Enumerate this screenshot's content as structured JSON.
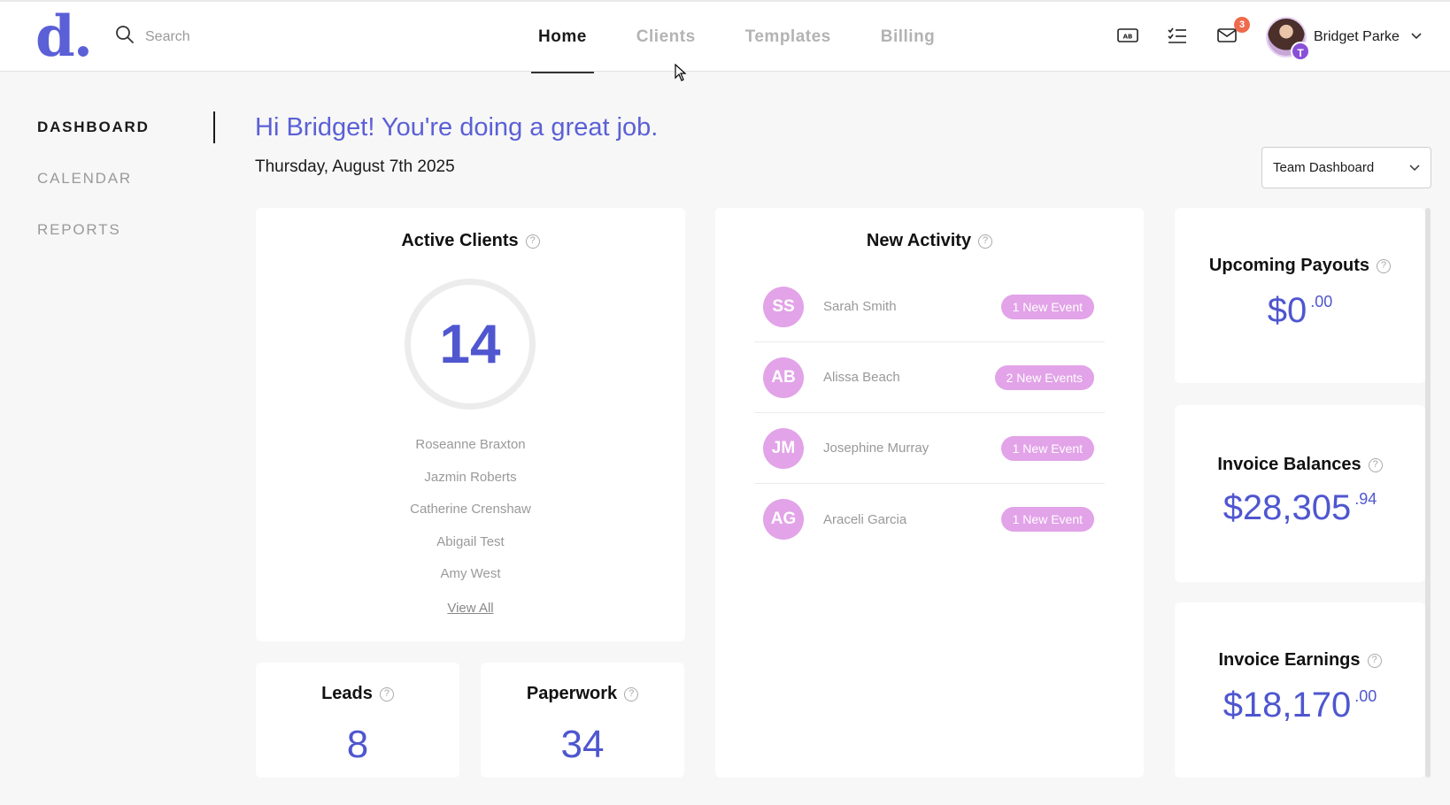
{
  "header": {
    "logo": "d.",
    "search_placeholder": "Search",
    "nav": [
      {
        "label": "Home",
        "active": true
      },
      {
        "label": "Clients",
        "active": false
      },
      {
        "label": "Templates",
        "active": false
      },
      {
        "label": "Billing",
        "active": false
      }
    ],
    "icons": [
      "ab-icon",
      "checklist-icon",
      "mail-icon"
    ],
    "mail_badge": "3",
    "user": {
      "name": "Bridget Parke",
      "avatar_badge": "T"
    }
  },
  "sidebar": {
    "items": [
      {
        "label": "DASHBOARD",
        "active": true
      },
      {
        "label": "CALENDAR",
        "active": false
      },
      {
        "label": "REPORTS",
        "active": false
      }
    ]
  },
  "main": {
    "greeting": "Hi Bridget! You're doing a great job.",
    "date": "Thursday, August 7th 2025",
    "dashboard_select": "Team Dashboard"
  },
  "active_clients": {
    "title": "Active Clients",
    "count": "14",
    "clients": [
      "Roseanne Braxton",
      "Jazmin Roberts",
      "Catherine Crenshaw",
      "Abigail Test",
      "Amy West"
    ],
    "view_all": "View All"
  },
  "leads": {
    "title": "Leads",
    "value": "8"
  },
  "paperwork": {
    "title": "Paperwork",
    "value": "34"
  },
  "activity": {
    "title": "New Activity",
    "items": [
      {
        "initials": "SS",
        "name": "Sarah Smith",
        "events": "1 New Event"
      },
      {
        "initials": "AB",
        "name": "Alissa Beach",
        "events": "2 New Events"
      },
      {
        "initials": "JM",
        "name": "Josephine Murray",
        "events": "1 New Event"
      },
      {
        "initials": "AG",
        "name": "Araceli Garcia",
        "events": "1 New Event"
      }
    ]
  },
  "stats": {
    "payouts": {
      "title": "Upcoming Payouts",
      "whole": "$0",
      "cents": ".00"
    },
    "balances": {
      "title": "Invoice Balances",
      "whole": "$28,305",
      "cents": ".94"
    },
    "earnings": {
      "title": "Invoice Earnings",
      "whole": "$18,170",
      "cents": ".00"
    }
  },
  "colors": {
    "accent": "#4f56cf",
    "pill": "#e2a3e8",
    "badge": "#ef6a4c"
  }
}
